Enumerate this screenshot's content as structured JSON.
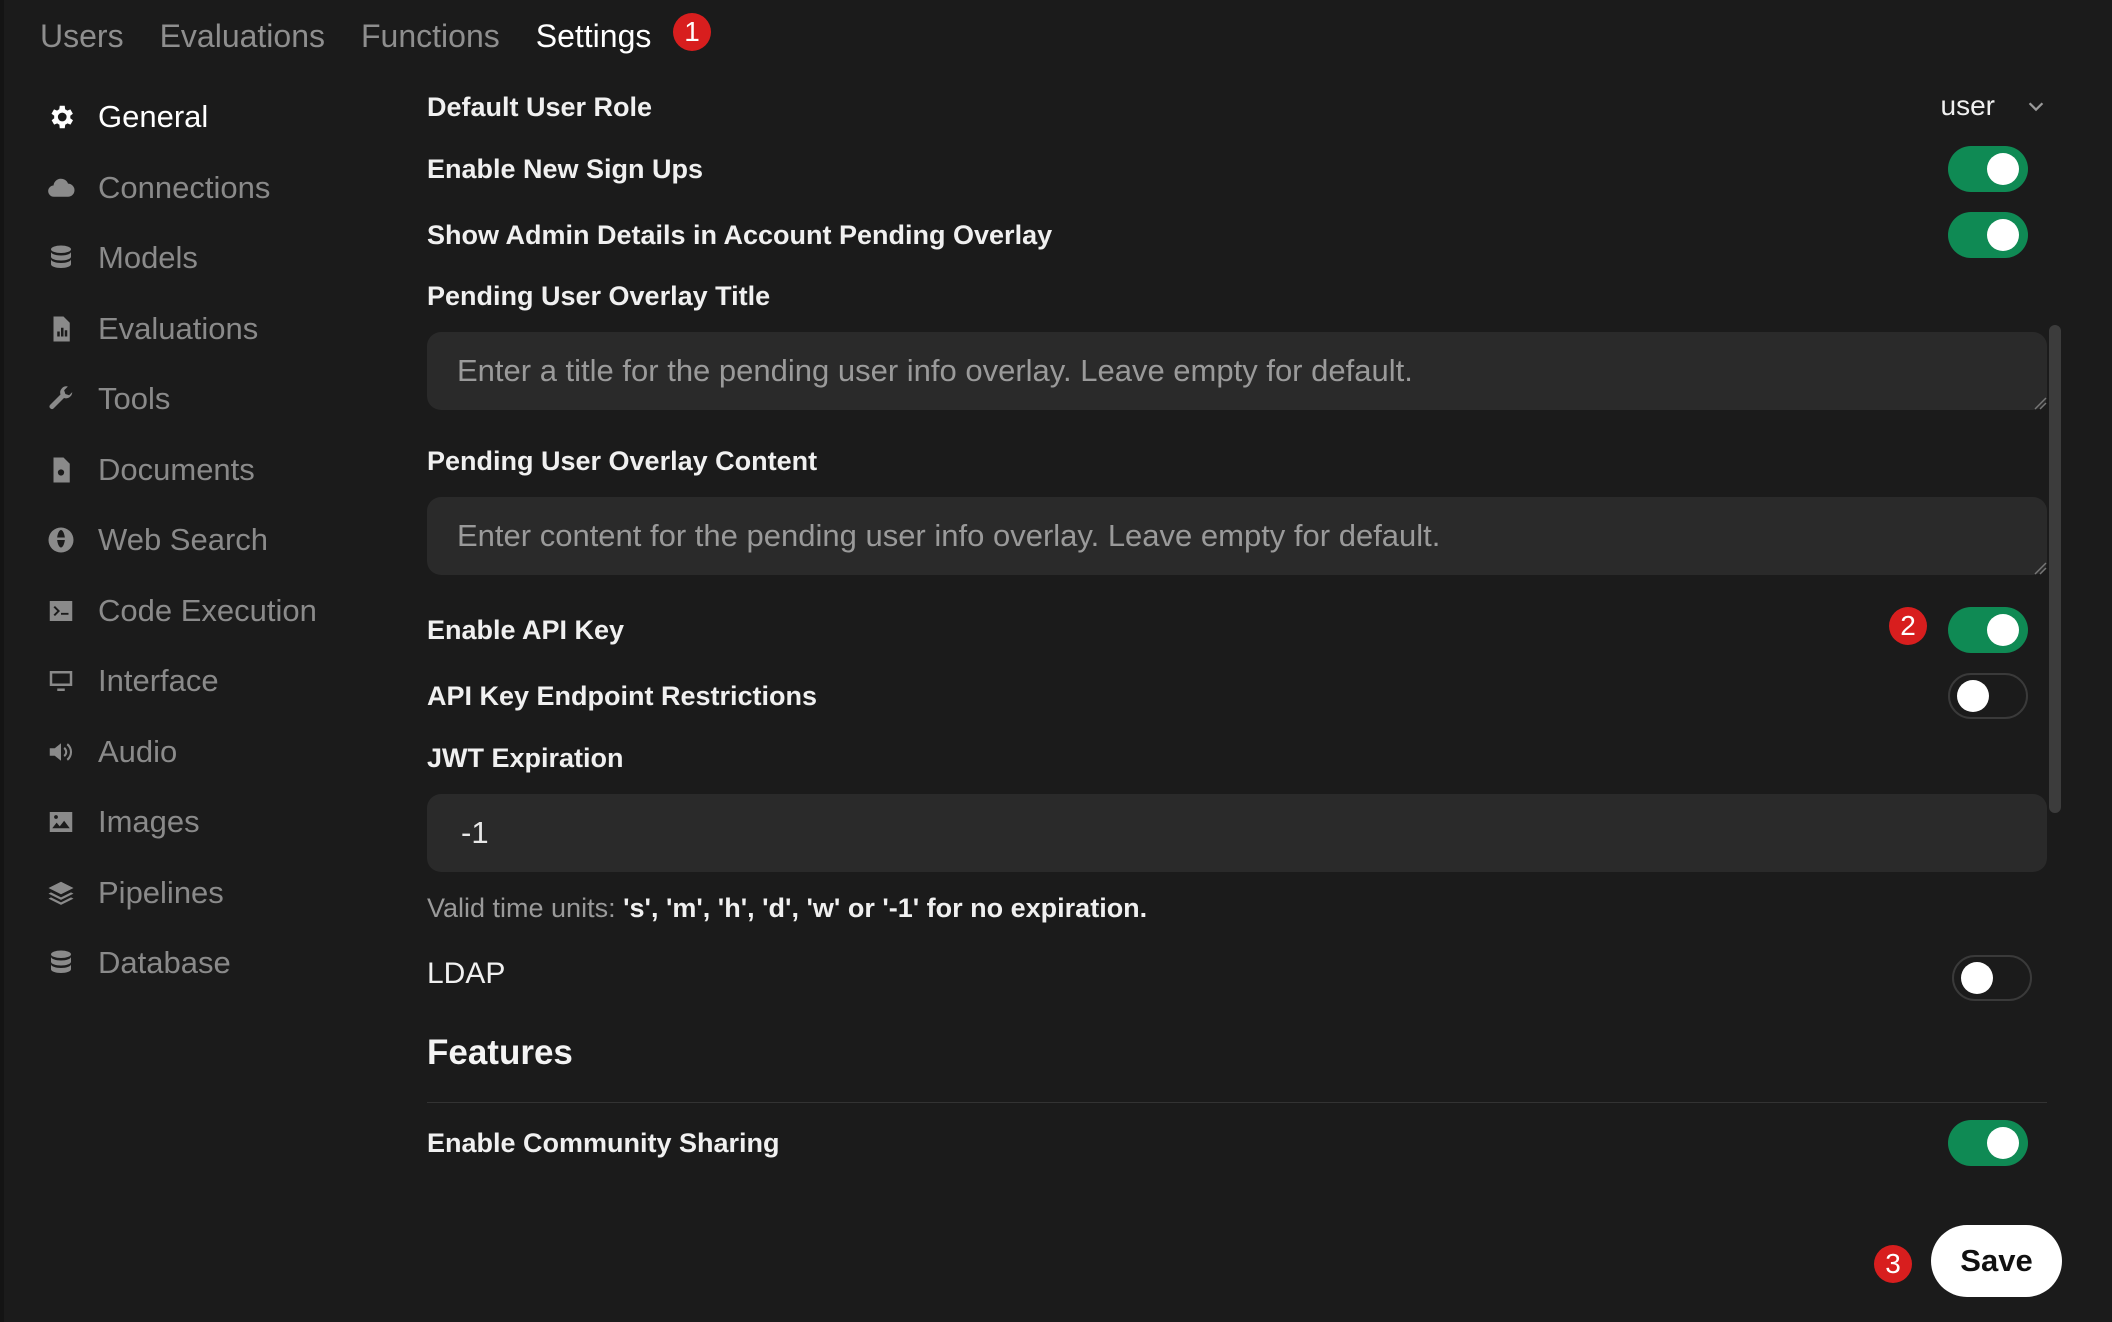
{
  "tabs": [
    {
      "label": "Users"
    },
    {
      "label": "Evaluations"
    },
    {
      "label": "Functions"
    },
    {
      "label": "Settings",
      "active": true
    }
  ],
  "annotations": [
    "1",
    "2",
    "3"
  ],
  "sidebar": {
    "items": [
      {
        "label": "General",
        "icon": "gear-icon",
        "active": true
      },
      {
        "label": "Connections",
        "icon": "cloud-icon"
      },
      {
        "label": "Models",
        "icon": "database-stack-icon"
      },
      {
        "label": "Evaluations",
        "icon": "document-chart-icon"
      },
      {
        "label": "Tools",
        "icon": "wrench-icon"
      },
      {
        "label": "Documents",
        "icon": "document-search-icon"
      },
      {
        "label": "Web Search",
        "icon": "globe-icon"
      },
      {
        "label": "Code Execution",
        "icon": "terminal-icon"
      },
      {
        "label": "Interface",
        "icon": "monitor-icon"
      },
      {
        "label": "Audio",
        "icon": "speaker-icon"
      },
      {
        "label": "Images",
        "icon": "image-icon"
      },
      {
        "label": "Pipelines",
        "icon": "layers-icon"
      },
      {
        "label": "Database",
        "icon": "database-icon"
      }
    ]
  },
  "general": {
    "default_role": {
      "label": "Default User Role",
      "value": "user"
    },
    "enable_signups": {
      "label": "Enable New Sign Ups",
      "enabled": true
    },
    "show_admin_details": {
      "label": "Show Admin Details in Account Pending Overlay",
      "enabled": true
    },
    "overlay_title": {
      "label": "Pending User Overlay Title",
      "placeholder": "Enter a title for the pending user info overlay. Leave empty for default.",
      "value": ""
    },
    "overlay_content": {
      "label": "Pending User Overlay Content",
      "placeholder": "Enter content for the pending user info overlay. Leave empty for default.",
      "value": ""
    },
    "enable_api_key": {
      "label": "Enable API Key",
      "enabled": true
    },
    "api_key_restrictions": {
      "label": "API Key Endpoint Restrictions",
      "enabled": false
    },
    "jwt": {
      "label": "JWT Expiration",
      "value": "-1",
      "hint_prefix": "Valid time units:",
      "hint_units": "'s', 'm', 'h', 'd', 'w' or '-1' for no expiration."
    },
    "ldap": {
      "label": "LDAP",
      "enabled": false
    }
  },
  "features": {
    "title": "Features",
    "community_sharing": {
      "label": "Enable Community Sharing",
      "enabled": true
    }
  },
  "save_label": "Save",
  "colors": {
    "toggle_on": "#0f8a54",
    "badge": "#d81e1e",
    "background": "#1b1b1b"
  }
}
